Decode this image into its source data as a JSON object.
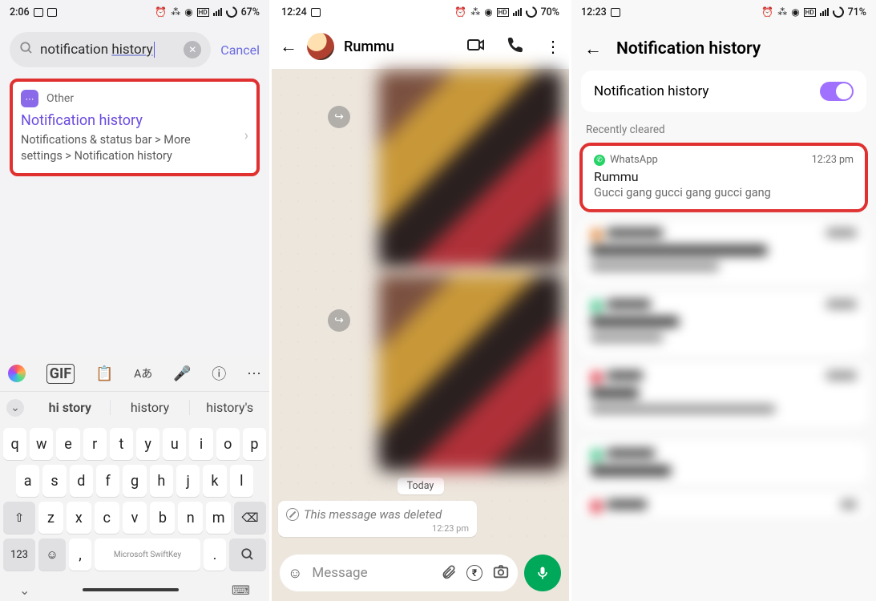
{
  "screen1": {
    "status": {
      "time": "2:06",
      "battery": "67%"
    },
    "search": {
      "query_prefix": "notification ",
      "query_underlined": "history",
      "cancel": "Cancel"
    },
    "result": {
      "category": "Other",
      "title": "Notification history",
      "path": "Notifications & status bar > More settings > Notification history"
    },
    "keyboard": {
      "predictions": [
        "hi story",
        "history",
        "history's"
      ],
      "rows": [
        [
          "q",
          "w",
          "e",
          "r",
          "t",
          "y",
          "u",
          "i",
          "o",
          "p"
        ],
        [
          "a",
          "s",
          "d",
          "f",
          "g",
          "h",
          "j",
          "k",
          "l"
        ],
        [
          "z",
          "x",
          "c",
          "v",
          "b",
          "n",
          "m"
        ]
      ],
      "shift": "⇧",
      "backspace": "⌫",
      "num": "123",
      "space_brand": "Microsoft SwiftKey",
      "comma": ",",
      "period": ".",
      "search_key": "🔍"
    }
  },
  "screen2": {
    "status": {
      "time": "12:24",
      "battery": "70%"
    },
    "chat": {
      "name": "Rummu",
      "date_label": "Today",
      "deleted_text": "This message was deleted",
      "deleted_time": "12:23 pm",
      "input_placeholder": "Message"
    }
  },
  "screen3": {
    "status": {
      "time": "12:23",
      "battery": "71%"
    },
    "header": "Notification history",
    "toggle_label": "Notification history",
    "toggle_on": true,
    "section": "Recently cleared",
    "highlight": {
      "app": "WhatsApp",
      "time": "12:23 pm",
      "title": "Rummu",
      "message": "Gucci gang gucci gang gucci gang"
    }
  }
}
